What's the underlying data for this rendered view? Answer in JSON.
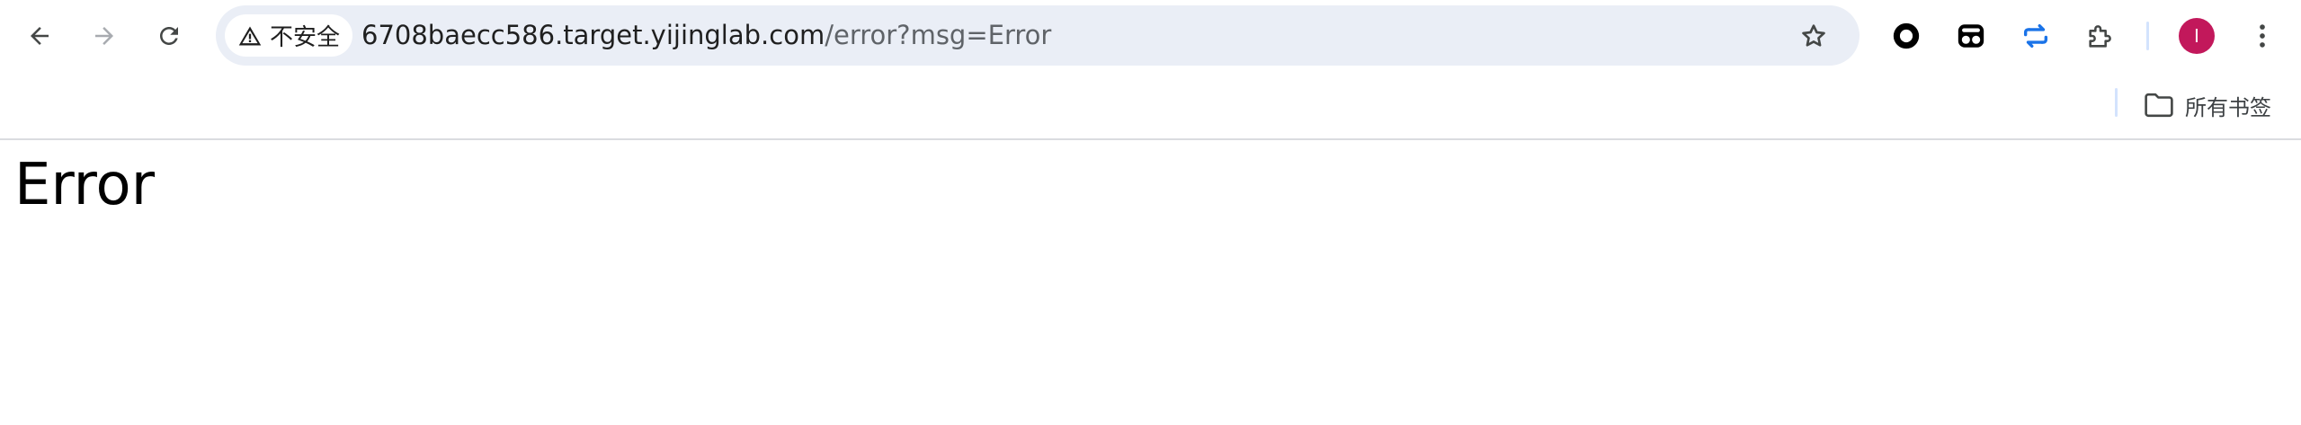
{
  "browser": {
    "nav": {
      "back_icon": "arrow-left-icon",
      "forward_icon": "arrow-right-icon",
      "reload_icon": "reload-icon"
    },
    "omnibox": {
      "security_label": "不安全",
      "security_icon": "warning-triangle-icon",
      "url_host": "6708baecc586.target.yijinglab.com",
      "url_path": "/error?msg=Error",
      "bookmark_icon": "star-icon"
    },
    "extensions": [
      {
        "name": "circle-record-extension-icon"
      },
      {
        "name": "dual-face-extension-icon"
      },
      {
        "name": "sync-arrows-extension-icon"
      },
      {
        "name": "puzzle-extensions-icon"
      }
    ],
    "profile": {
      "initial": "I",
      "color": "#c2185b"
    },
    "menu_icon": "kebab-menu-icon",
    "bookmarks_bar": {
      "all_bookmarks_label": "所有书签",
      "folder_icon": "folder-icon"
    }
  },
  "page": {
    "heading": "Error"
  },
  "colors": {
    "omnibox_bg": "#eaeef6",
    "accent_blue": "#1a73e8",
    "divider": "#d3e3fd"
  }
}
